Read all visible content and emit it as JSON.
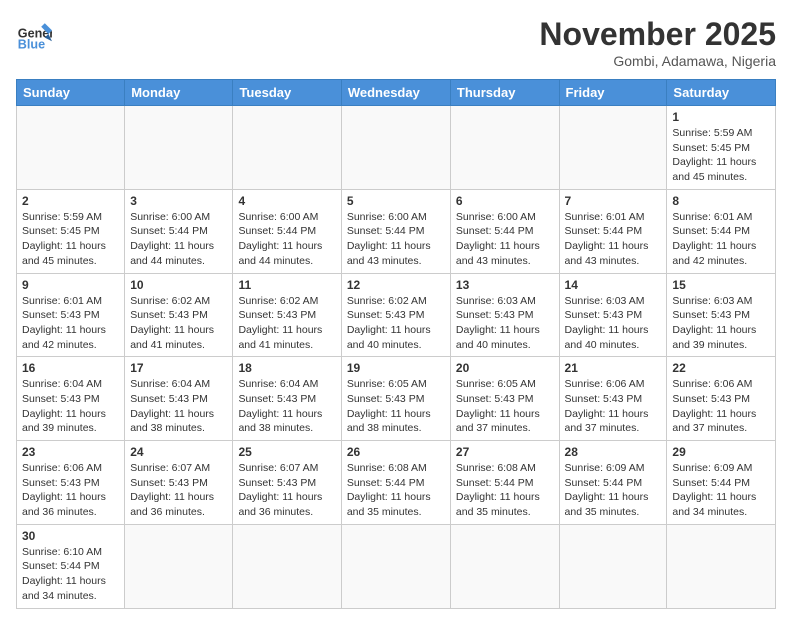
{
  "header": {
    "logo_general": "General",
    "logo_blue": "Blue",
    "month_title": "November 2025",
    "location": "Gombi, Adamawa, Nigeria"
  },
  "weekdays": [
    "Sunday",
    "Monday",
    "Tuesday",
    "Wednesday",
    "Thursday",
    "Friday",
    "Saturday"
  ],
  "weeks": [
    [
      {
        "day": "",
        "sunrise": "",
        "sunset": "",
        "daylight": ""
      },
      {
        "day": "",
        "sunrise": "",
        "sunset": "",
        "daylight": ""
      },
      {
        "day": "",
        "sunrise": "",
        "sunset": "",
        "daylight": ""
      },
      {
        "day": "",
        "sunrise": "",
        "sunset": "",
        "daylight": ""
      },
      {
        "day": "",
        "sunrise": "",
        "sunset": "",
        "daylight": ""
      },
      {
        "day": "",
        "sunrise": "",
        "sunset": "",
        "daylight": ""
      },
      {
        "day": "1",
        "sunrise": "Sunrise: 5:59 AM",
        "sunset": "Sunset: 5:45 PM",
        "daylight": "Daylight: 11 hours and 45 minutes."
      }
    ],
    [
      {
        "day": "2",
        "sunrise": "Sunrise: 5:59 AM",
        "sunset": "Sunset: 5:45 PM",
        "daylight": "Daylight: 11 hours and 45 minutes."
      },
      {
        "day": "3",
        "sunrise": "Sunrise: 6:00 AM",
        "sunset": "Sunset: 5:44 PM",
        "daylight": "Daylight: 11 hours and 44 minutes."
      },
      {
        "day": "4",
        "sunrise": "Sunrise: 6:00 AM",
        "sunset": "Sunset: 5:44 PM",
        "daylight": "Daylight: 11 hours and 44 minutes."
      },
      {
        "day": "5",
        "sunrise": "Sunrise: 6:00 AM",
        "sunset": "Sunset: 5:44 PM",
        "daylight": "Daylight: 11 hours and 43 minutes."
      },
      {
        "day": "6",
        "sunrise": "Sunrise: 6:00 AM",
        "sunset": "Sunset: 5:44 PM",
        "daylight": "Daylight: 11 hours and 43 minutes."
      },
      {
        "day": "7",
        "sunrise": "Sunrise: 6:01 AM",
        "sunset": "Sunset: 5:44 PM",
        "daylight": "Daylight: 11 hours and 43 minutes."
      },
      {
        "day": "8",
        "sunrise": "Sunrise: 6:01 AM",
        "sunset": "Sunset: 5:44 PM",
        "daylight": "Daylight: 11 hours and 42 minutes."
      }
    ],
    [
      {
        "day": "9",
        "sunrise": "Sunrise: 6:01 AM",
        "sunset": "Sunset: 5:43 PM",
        "daylight": "Daylight: 11 hours and 42 minutes."
      },
      {
        "day": "10",
        "sunrise": "Sunrise: 6:02 AM",
        "sunset": "Sunset: 5:43 PM",
        "daylight": "Daylight: 11 hours and 41 minutes."
      },
      {
        "day": "11",
        "sunrise": "Sunrise: 6:02 AM",
        "sunset": "Sunset: 5:43 PM",
        "daylight": "Daylight: 11 hours and 41 minutes."
      },
      {
        "day": "12",
        "sunrise": "Sunrise: 6:02 AM",
        "sunset": "Sunset: 5:43 PM",
        "daylight": "Daylight: 11 hours and 40 minutes."
      },
      {
        "day": "13",
        "sunrise": "Sunrise: 6:03 AM",
        "sunset": "Sunset: 5:43 PM",
        "daylight": "Daylight: 11 hours and 40 minutes."
      },
      {
        "day": "14",
        "sunrise": "Sunrise: 6:03 AM",
        "sunset": "Sunset: 5:43 PM",
        "daylight": "Daylight: 11 hours and 40 minutes."
      },
      {
        "day": "15",
        "sunrise": "Sunrise: 6:03 AM",
        "sunset": "Sunset: 5:43 PM",
        "daylight": "Daylight: 11 hours and 39 minutes."
      }
    ],
    [
      {
        "day": "16",
        "sunrise": "Sunrise: 6:04 AM",
        "sunset": "Sunset: 5:43 PM",
        "daylight": "Daylight: 11 hours and 39 minutes."
      },
      {
        "day": "17",
        "sunrise": "Sunrise: 6:04 AM",
        "sunset": "Sunset: 5:43 PM",
        "daylight": "Daylight: 11 hours and 38 minutes."
      },
      {
        "day": "18",
        "sunrise": "Sunrise: 6:04 AM",
        "sunset": "Sunset: 5:43 PM",
        "daylight": "Daylight: 11 hours and 38 minutes."
      },
      {
        "day": "19",
        "sunrise": "Sunrise: 6:05 AM",
        "sunset": "Sunset: 5:43 PM",
        "daylight": "Daylight: 11 hours and 38 minutes."
      },
      {
        "day": "20",
        "sunrise": "Sunrise: 6:05 AM",
        "sunset": "Sunset: 5:43 PM",
        "daylight": "Daylight: 11 hours and 37 minutes."
      },
      {
        "day": "21",
        "sunrise": "Sunrise: 6:06 AM",
        "sunset": "Sunset: 5:43 PM",
        "daylight": "Daylight: 11 hours and 37 minutes."
      },
      {
        "day": "22",
        "sunrise": "Sunrise: 6:06 AM",
        "sunset": "Sunset: 5:43 PM",
        "daylight": "Daylight: 11 hours and 37 minutes."
      }
    ],
    [
      {
        "day": "23",
        "sunrise": "Sunrise: 6:06 AM",
        "sunset": "Sunset: 5:43 PM",
        "daylight": "Daylight: 11 hours and 36 minutes."
      },
      {
        "day": "24",
        "sunrise": "Sunrise: 6:07 AM",
        "sunset": "Sunset: 5:43 PM",
        "daylight": "Daylight: 11 hours and 36 minutes."
      },
      {
        "day": "25",
        "sunrise": "Sunrise: 6:07 AM",
        "sunset": "Sunset: 5:43 PM",
        "daylight": "Daylight: 11 hours and 36 minutes."
      },
      {
        "day": "26",
        "sunrise": "Sunrise: 6:08 AM",
        "sunset": "Sunset: 5:44 PM",
        "daylight": "Daylight: 11 hours and 35 minutes."
      },
      {
        "day": "27",
        "sunrise": "Sunrise: 6:08 AM",
        "sunset": "Sunset: 5:44 PM",
        "daylight": "Daylight: 11 hours and 35 minutes."
      },
      {
        "day": "28",
        "sunrise": "Sunrise: 6:09 AM",
        "sunset": "Sunset: 5:44 PM",
        "daylight": "Daylight: 11 hours and 35 minutes."
      },
      {
        "day": "29",
        "sunrise": "Sunrise: 6:09 AM",
        "sunset": "Sunset: 5:44 PM",
        "daylight": "Daylight: 11 hours and 34 minutes."
      }
    ],
    [
      {
        "day": "30",
        "sunrise": "Sunrise: 6:10 AM",
        "sunset": "Sunset: 5:44 PM",
        "daylight": "Daylight: 11 hours and 34 minutes."
      },
      {
        "day": "",
        "sunrise": "",
        "sunset": "",
        "daylight": ""
      },
      {
        "day": "",
        "sunrise": "",
        "sunset": "",
        "daylight": ""
      },
      {
        "day": "",
        "sunrise": "",
        "sunset": "",
        "daylight": ""
      },
      {
        "day": "",
        "sunrise": "",
        "sunset": "",
        "daylight": ""
      },
      {
        "day": "",
        "sunrise": "",
        "sunset": "",
        "daylight": ""
      },
      {
        "day": "",
        "sunrise": "",
        "sunset": "",
        "daylight": ""
      }
    ]
  ]
}
